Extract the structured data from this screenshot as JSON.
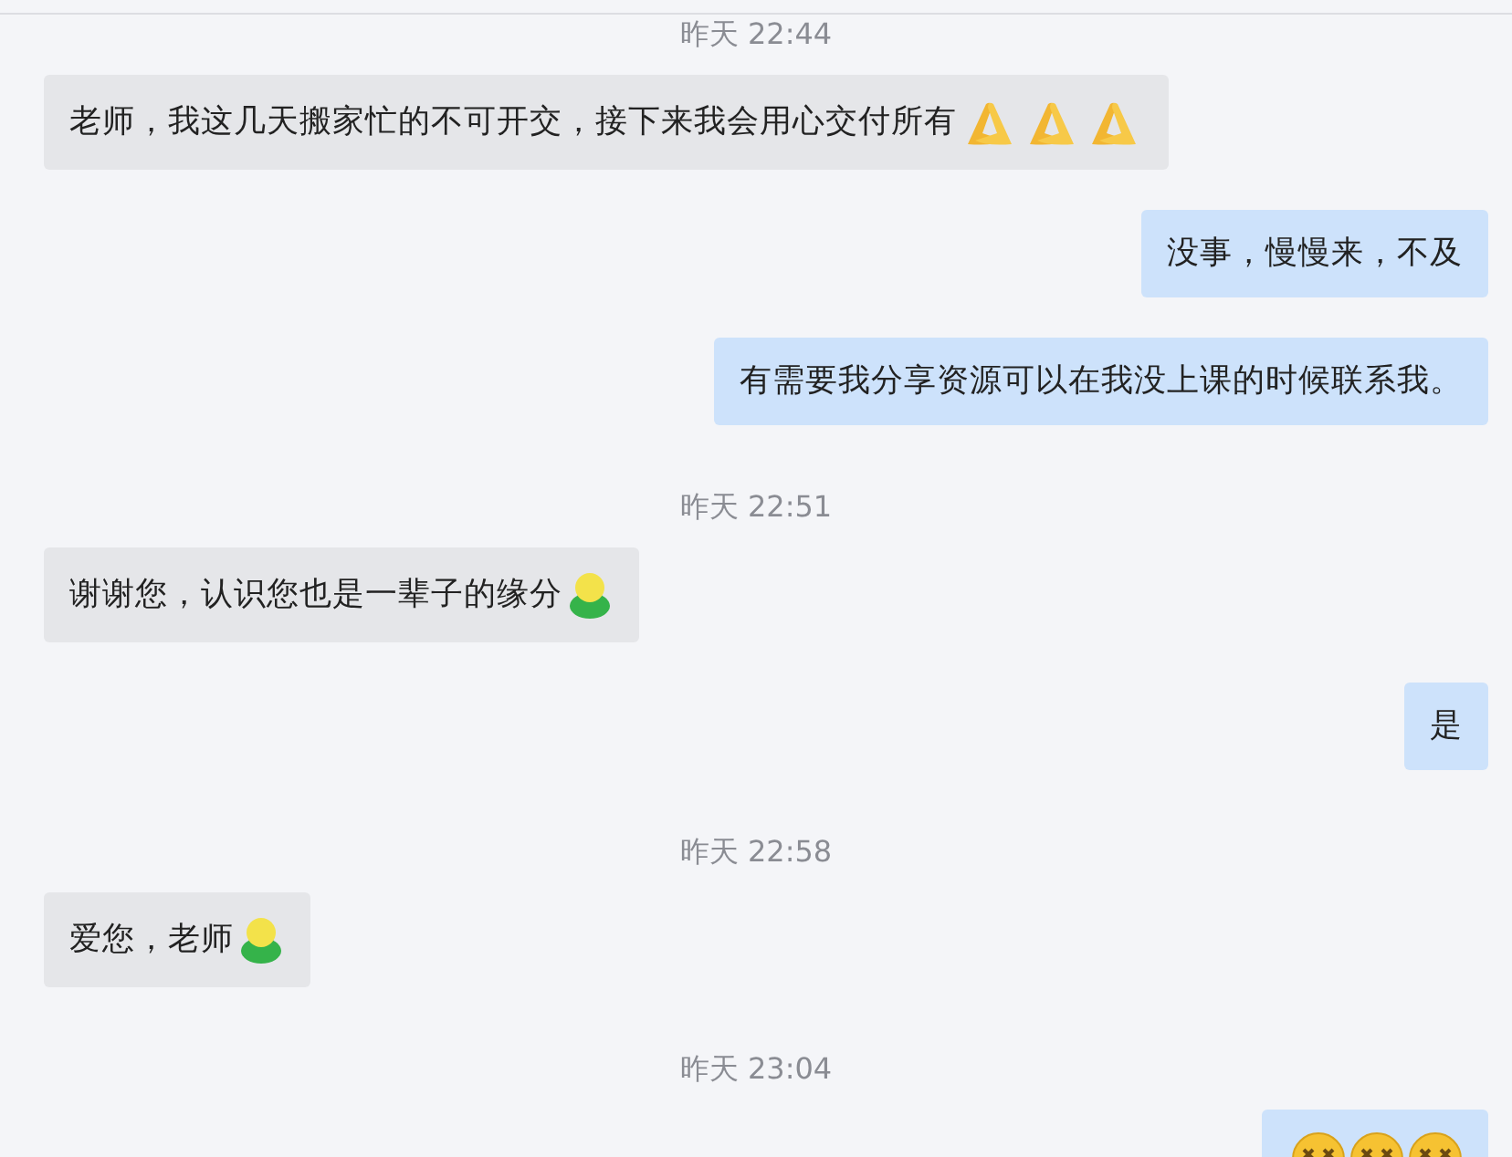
{
  "messages": [
    {
      "kind": "time",
      "text": "昨天 22:44"
    },
    {
      "kind": "message",
      "outgoing": false,
      "text": "老师，我这几天搬家忙的不可开交，接下来我会用心交付所有",
      "emoji": [
        {
          "kind": "pray"
        },
        {
          "kind": "pray"
        },
        {
          "kind": "pray"
        }
      ]
    },
    {
      "kind": "message",
      "outgoing": true,
      "text": "没事，慢慢来，不及"
    },
    {
      "kind": "message",
      "outgoing": true,
      "text": "有需要我分享资源可以在我没上课的时候联系我。"
    },
    {
      "kind": "time",
      "text": "昨天 22:51"
    },
    {
      "kind": "message",
      "outgoing": false,
      "text": "谢谢您，认识您也是一辈子的缘分",
      "emoji": [
        {
          "kind": "figure"
        }
      ]
    },
    {
      "kind": "message",
      "outgoing": true,
      "text": "是"
    },
    {
      "kind": "time",
      "text": "昨天 22:58"
    },
    {
      "kind": "message",
      "outgoing": false,
      "text": "爱您，老师",
      "emoji": [
        {
          "kind": "figure"
        }
      ]
    },
    {
      "kind": "time",
      "text": "昨天 23:04"
    },
    {
      "kind": "message",
      "outgoing": true,
      "emoji": [
        {
          "kind": "dizzy"
        },
        {
          "kind": "dizzy"
        },
        {
          "kind": "dizzy"
        }
      ]
    }
  ]
}
